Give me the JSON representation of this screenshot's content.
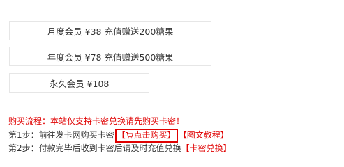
{
  "plans": [
    {
      "label": "月度会员 ¥38 充值赠送200糖果"
    },
    {
      "label": "年度会员 ¥78 充值赠送500糖果"
    },
    {
      "label": "永久会员 ¥108"
    }
  ],
  "flow": {
    "title": "购买流程：本站仅支持卡密兑换请先购买卡密！",
    "step1": {
      "prefix": "第1步：前往发卡网购买卡密",
      "open_bracket": "【",
      "buy_label": "点击购买",
      "close_bracket": "】",
      "tutorial_label": "【图文教程】"
    },
    "step2": {
      "prefix": "第2步：付款完毕后收到卡密后请及时充值兑换",
      "redeem_label": "【卡密兑换】"
    }
  },
  "colors": {
    "accent": "#e00000",
    "text": "#333333",
    "border": "#e6e6e6"
  },
  "icons": {
    "buy": "cart-icon"
  }
}
